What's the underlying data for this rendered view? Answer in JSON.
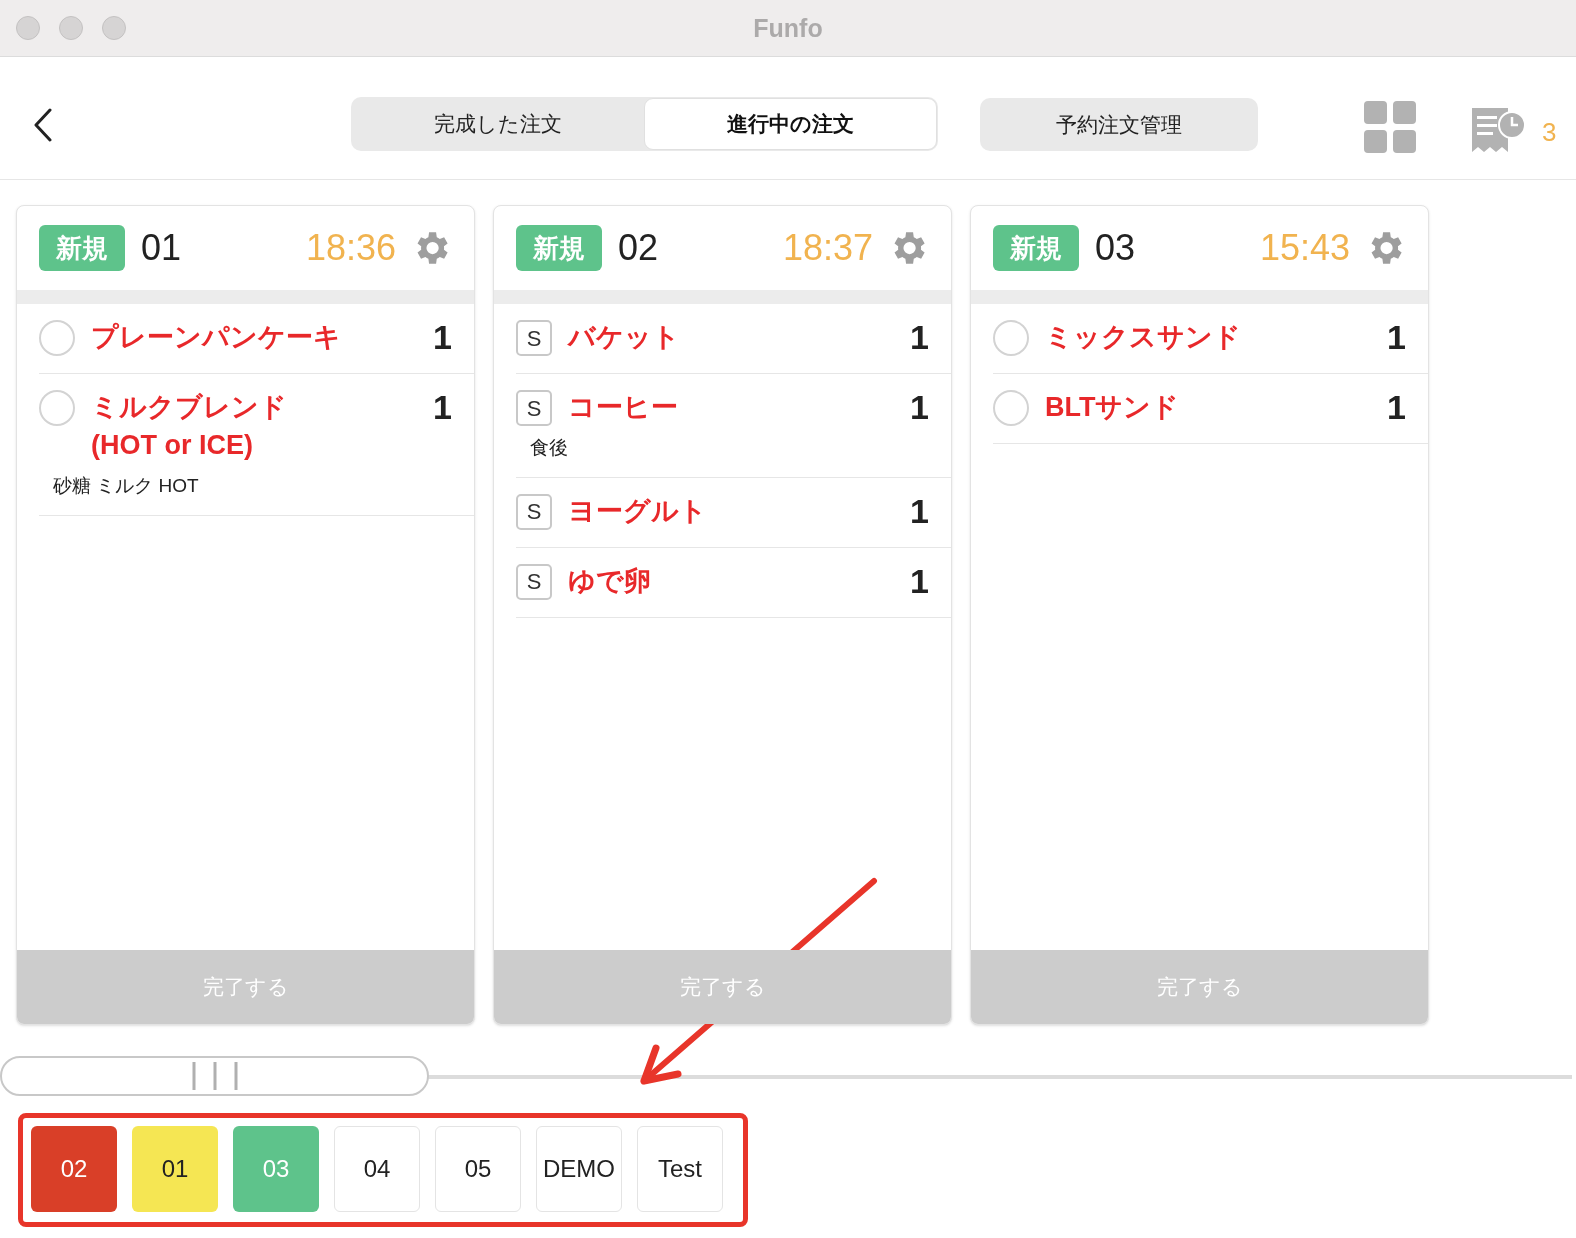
{
  "window": {
    "title": "Funfo"
  },
  "tabs": [
    {
      "label": "完成した注文",
      "selected": false
    },
    {
      "label": "進行中の注文",
      "selected": true
    }
  ],
  "reservation_button": "予約注文管理",
  "receipt_count": "3",
  "orders": [
    {
      "badge": "新規",
      "table": "01",
      "time": "18:36",
      "complete_label": "完了する",
      "items": [
        {
          "kind": "check",
          "checked": false,
          "name": "プレーンパンケーキ",
          "qty": "1"
        },
        {
          "kind": "check",
          "checked": false,
          "name": "ミルクブレンド\n(HOT or ICE)",
          "qty": "1",
          "note": "砂糖 ミルク HOT"
        }
      ]
    },
    {
      "badge": "新規",
      "table": "02",
      "time": "18:37",
      "complete_label": "完了する",
      "items": [
        {
          "kind": "tag",
          "tag": "S",
          "name": "バケット",
          "qty": "1"
        },
        {
          "kind": "tag",
          "tag": "S",
          "name": "コーヒー",
          "qty": "1",
          "note": "食後"
        },
        {
          "kind": "tag",
          "tag": "S",
          "name": "ヨーグルト",
          "qty": "1"
        },
        {
          "kind": "tag",
          "tag": "S",
          "name": "ゆで卵",
          "qty": "1"
        }
      ]
    },
    {
      "badge": "新規",
      "table": "03",
      "time": "15:43",
      "complete_label": "完了する",
      "items": [
        {
          "kind": "check",
          "checked": false,
          "name": "ミックスサンド",
          "qty": "1"
        },
        {
          "kind": "check",
          "checked": false,
          "name": "BLTサンド",
          "qty": "1"
        }
      ]
    }
  ],
  "tables": [
    {
      "label": "02",
      "color": "#d93f28"
    },
    {
      "label": "01",
      "color": "#f5e653"
    },
    {
      "label": "03",
      "color": "#5ec38b"
    },
    {
      "label": "04",
      "color": "#ffffff"
    },
    {
      "label": "05",
      "color": "#ffffff"
    },
    {
      "label": "DEMO",
      "color": "#ffffff"
    },
    {
      "label": "Test",
      "color": "#ffffff"
    }
  ]
}
